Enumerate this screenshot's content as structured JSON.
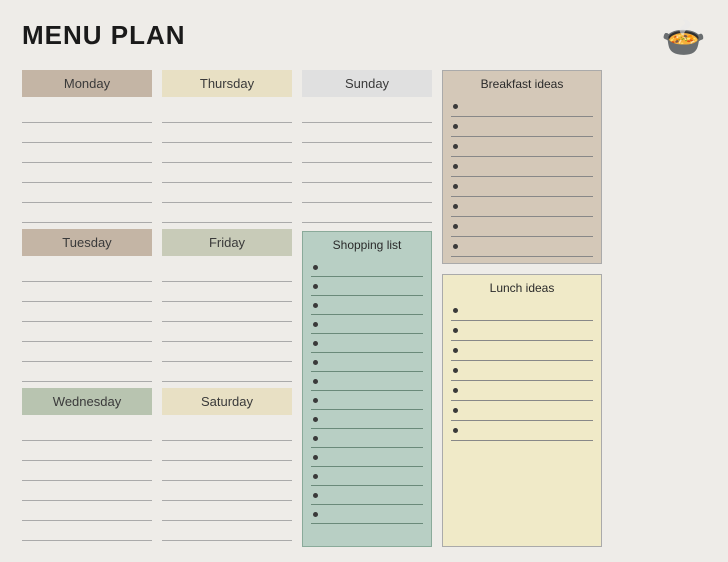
{
  "title": "MENU PLAN",
  "icon": "🍲",
  "days": {
    "col1": [
      {
        "label": "Monday",
        "class": "monday",
        "lines": 6
      },
      {
        "label": "Tuesday",
        "class": "tuesday",
        "lines": 6
      },
      {
        "label": "Wednesday",
        "class": "wednesday",
        "lines": 6
      }
    ],
    "col2": [
      {
        "label": "Thursday",
        "class": "thursday",
        "lines": 6
      },
      {
        "label": "Friday",
        "class": "friday",
        "lines": 6
      },
      {
        "label": "Saturday",
        "class": "saturday",
        "lines": 6
      }
    ],
    "col3": [
      {
        "label": "Sunday",
        "class": "sunday",
        "lines": 6
      }
    ]
  },
  "shopping": {
    "title": "Shopping list",
    "items": 14
  },
  "breakfast": {
    "title": "Breakfast ideas",
    "items": 8
  },
  "lunch": {
    "title": "Lunch ideas",
    "items": 7
  }
}
